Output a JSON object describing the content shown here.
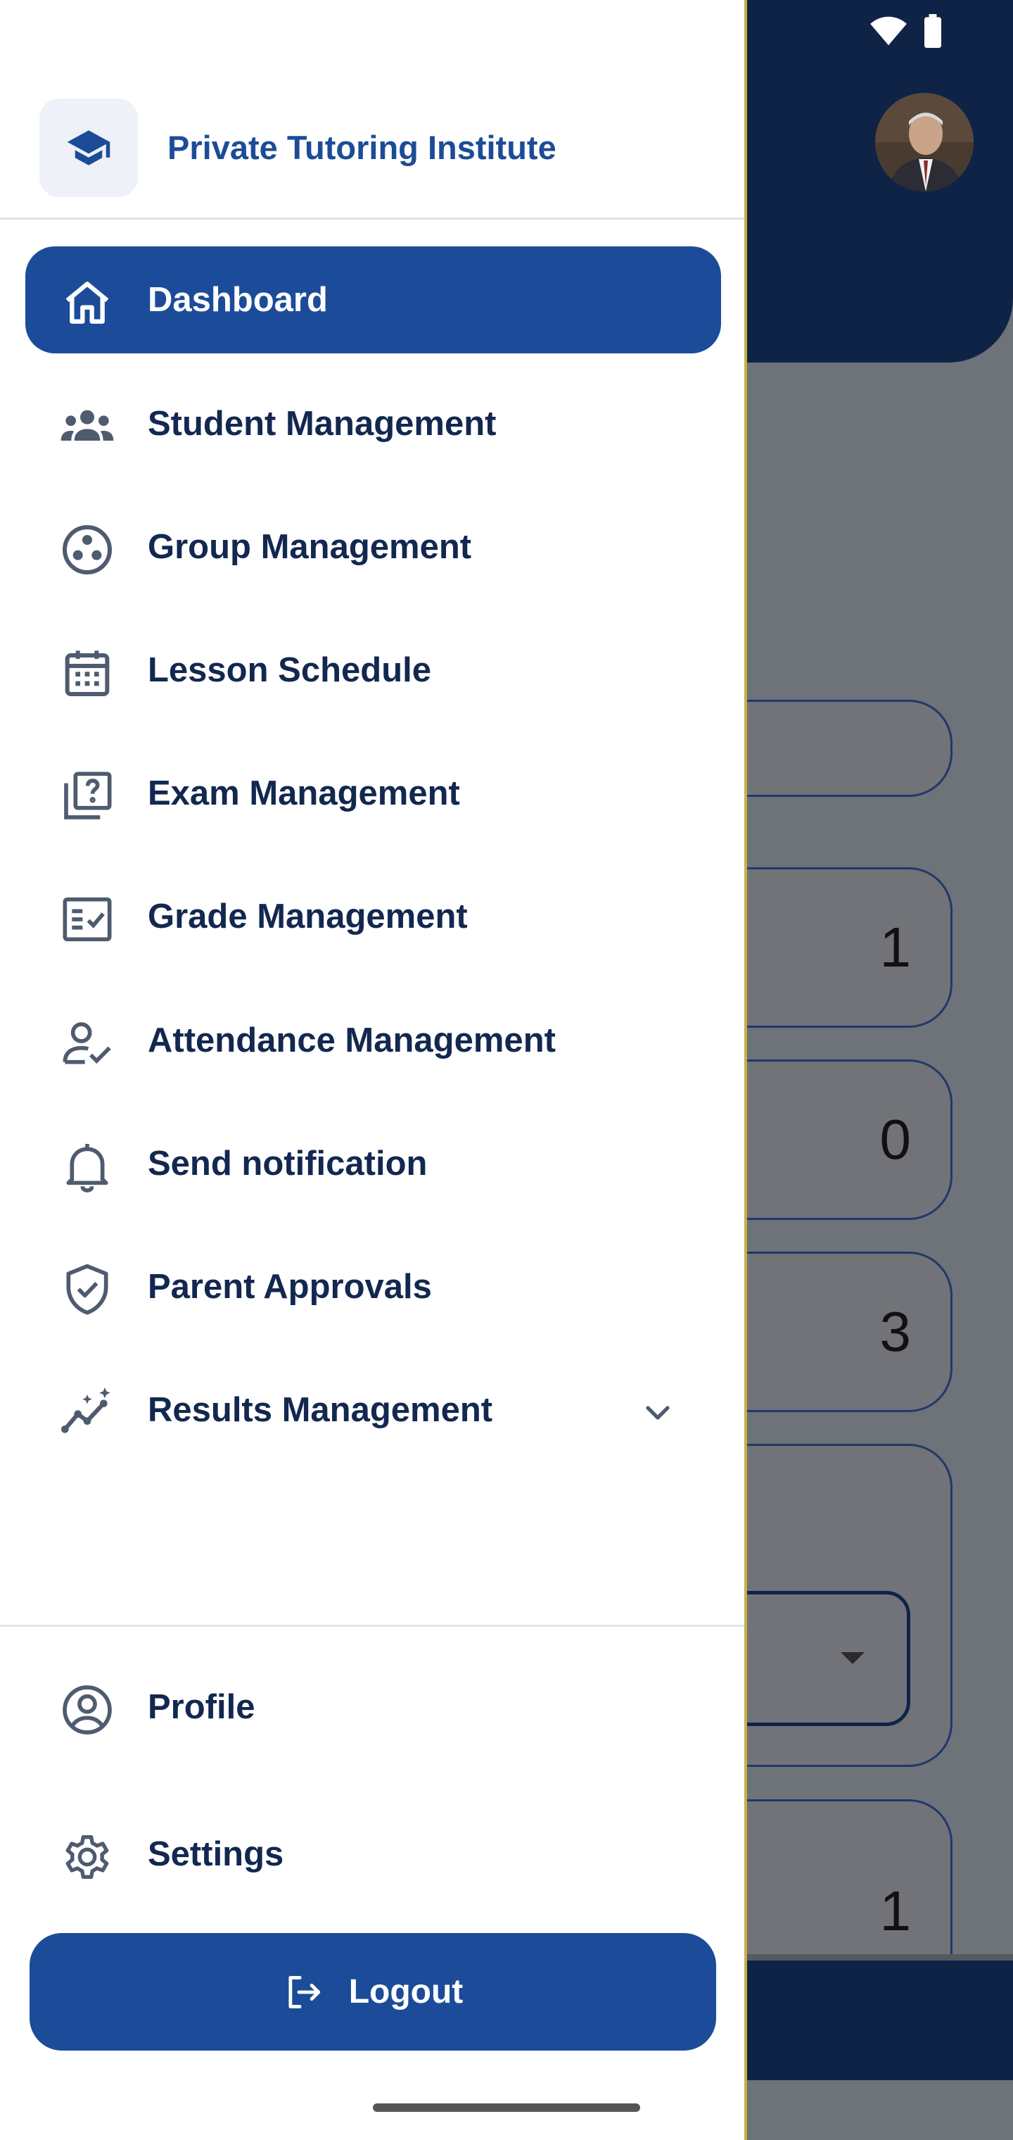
{
  "app": {
    "title": "Private Tutoring Institute"
  },
  "drawer": {
    "nav_items": [
      {
        "label": "Dashboard",
        "icon": "home-icon",
        "active": true
      },
      {
        "label": "Student Management",
        "icon": "group-icon"
      },
      {
        "label": "Group Management",
        "icon": "workspaces-icon"
      },
      {
        "label": "Lesson Schedule",
        "icon": "calendar-icon"
      },
      {
        "label": "Exam Management",
        "icon": "quiz-icon"
      },
      {
        "label": "Grade Management",
        "icon": "fact-check-icon"
      },
      {
        "label": "Attendance Management",
        "icon": "person-check-icon"
      },
      {
        "label": "Send notification",
        "icon": "bell-icon"
      },
      {
        "label": "Parent Approvals",
        "icon": "verified-shield-icon"
      },
      {
        "label": "Results Management",
        "icon": "insights-icon",
        "expandable": true
      }
    ],
    "footer_items": [
      {
        "label": "Profile",
        "icon": "account-circle-icon"
      },
      {
        "label": "Settings",
        "icon": "gear-icon"
      }
    ],
    "logout_label": "Logout"
  },
  "background": {
    "card_values": [
      "1",
      "0",
      "3",
      "1"
    ]
  },
  "colors": {
    "primary": "#1c4c99",
    "header_dark": "#0f2347",
    "nav_text": "#132850",
    "brand_text": "#1c4c97",
    "icon_gray": "#4f5b6e",
    "scrim": "#6e7279"
  }
}
